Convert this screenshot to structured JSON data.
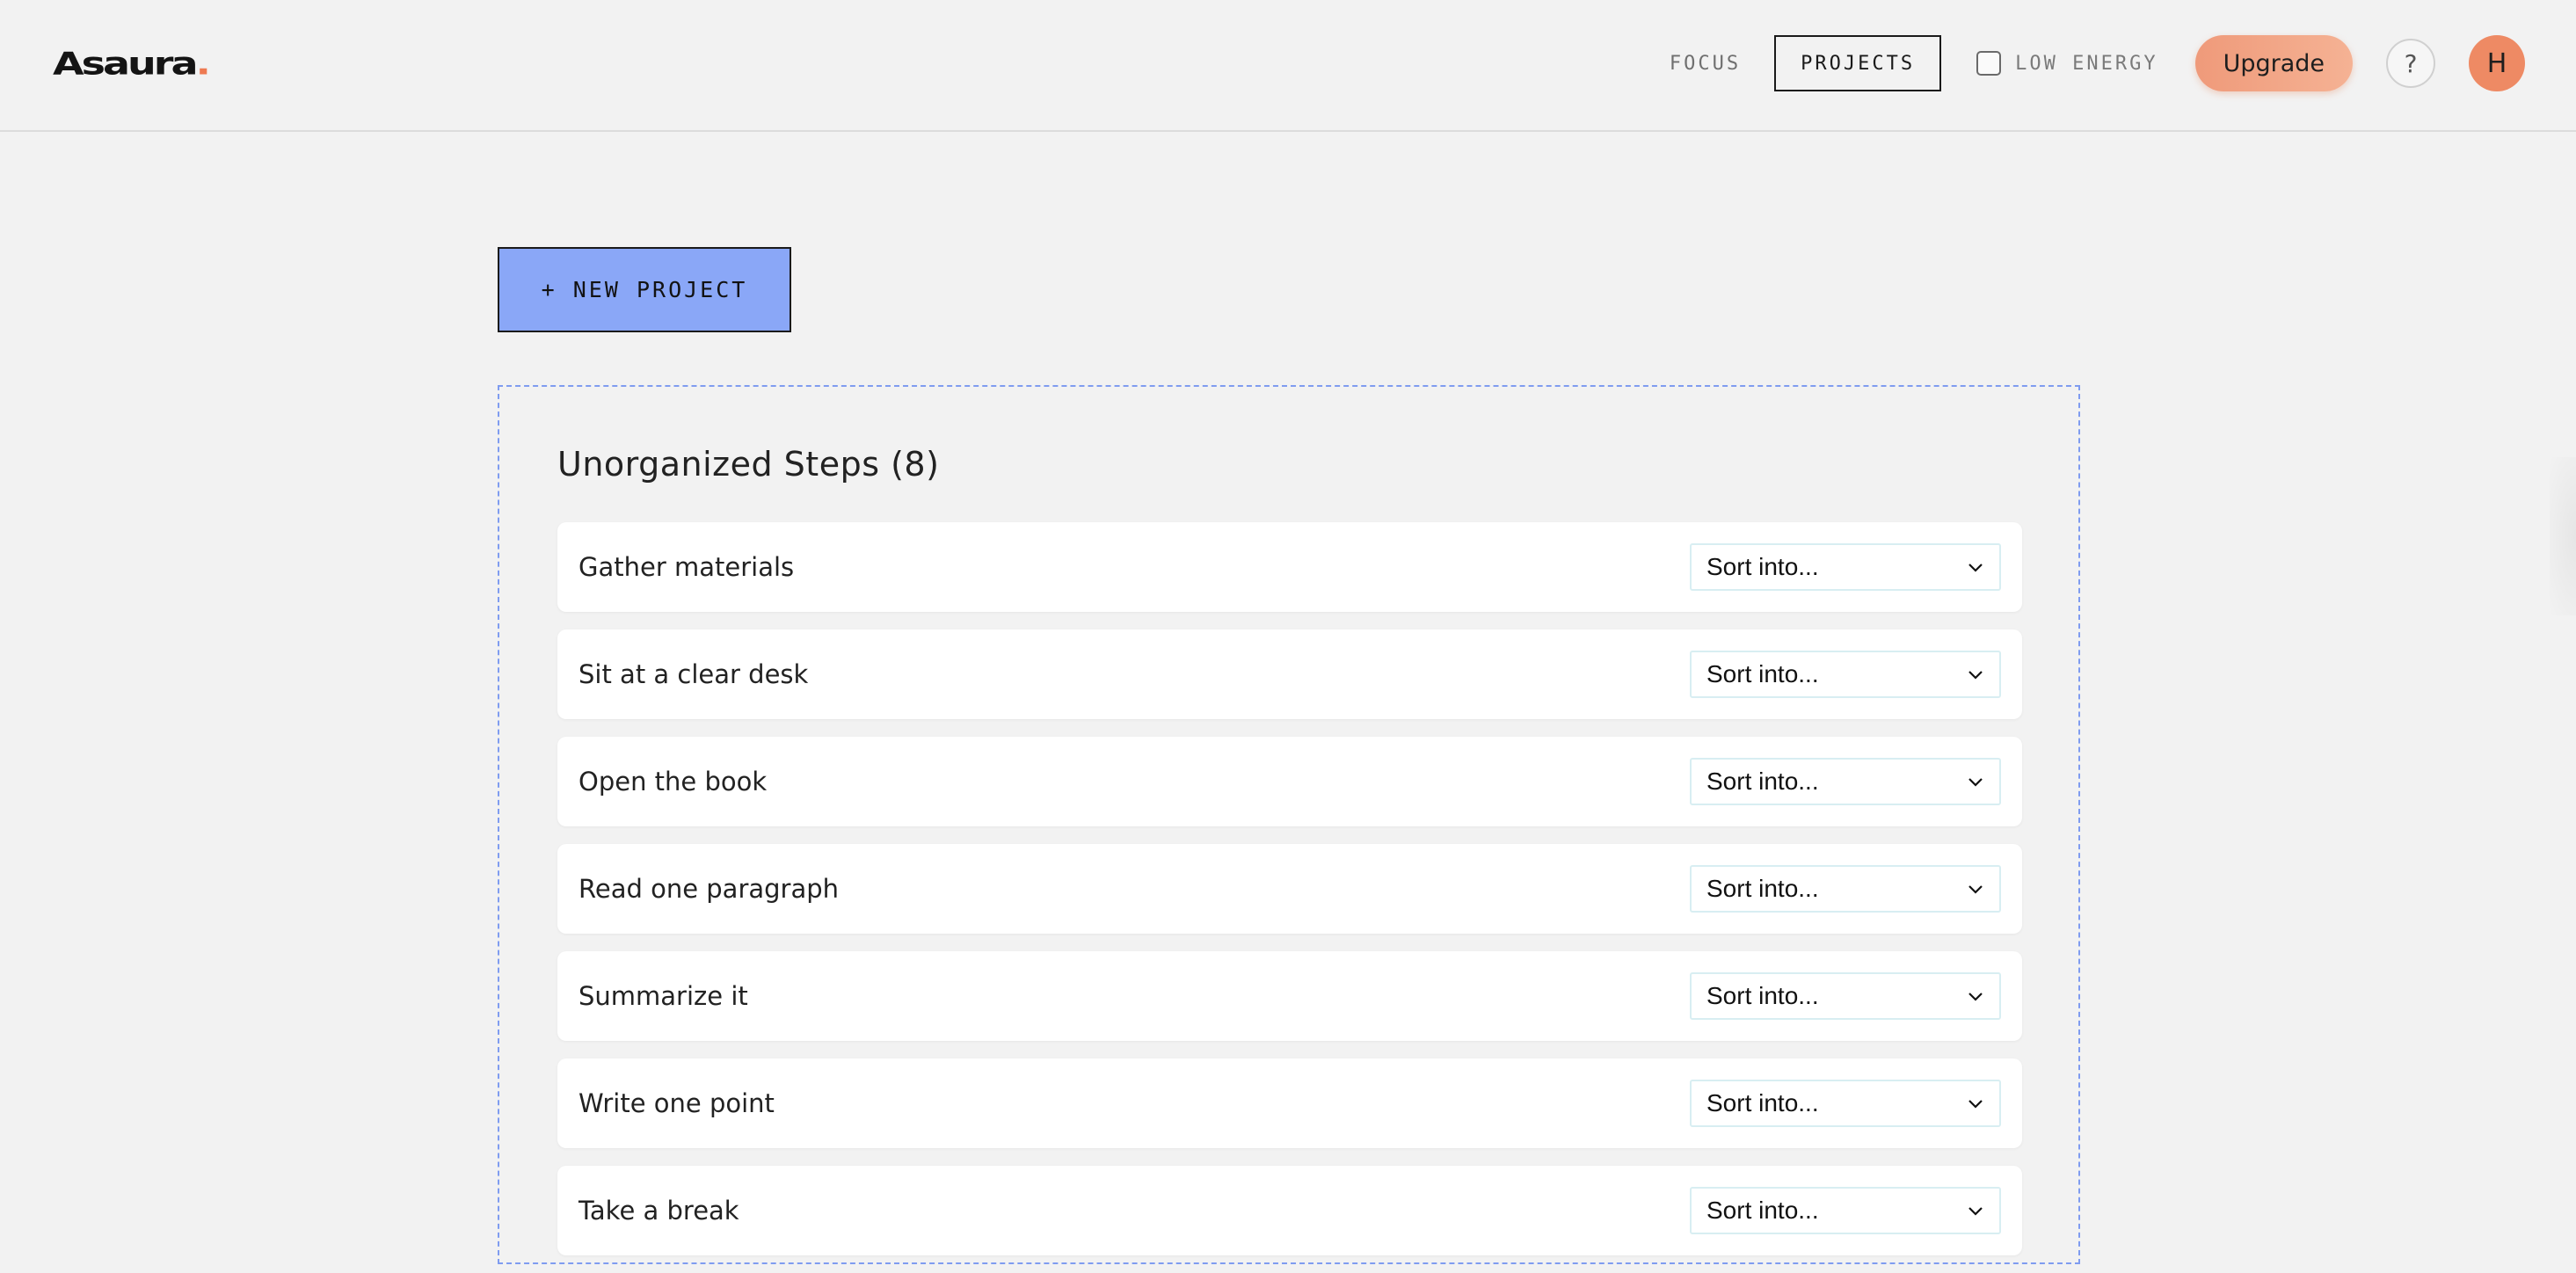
{
  "app": {
    "logo_text": "Asaura",
    "logo_dot": "."
  },
  "nav": {
    "focus_label": "FOCUS",
    "projects_label": "PROJECTS",
    "low_energy_label": "LOW ENERGY",
    "low_energy_checked": false,
    "upgrade_label": "Upgrade",
    "help_label": "?",
    "avatar_initial": "H"
  },
  "main": {
    "new_project_label": "+ NEW PROJECT",
    "section_title": "Unorganized Steps (8)",
    "steps": [
      {
        "label": "Gather materials",
        "select": "Sort into..."
      },
      {
        "label": "Sit at a clear desk",
        "select": "Sort into..."
      },
      {
        "label": "Open the book",
        "select": "Sort into..."
      },
      {
        "label": "Read one paragraph",
        "select": "Sort into..."
      },
      {
        "label": "Summarize it",
        "select": "Sort into..."
      },
      {
        "label": "Write one point",
        "select": "Sort into..."
      },
      {
        "label": "Take a break",
        "select": "Sort into..."
      }
    ]
  },
  "colors": {
    "background": "#f2f2f2",
    "accent_blue": "#8aa7f7",
    "upgrade_orange": "#ef9a7a",
    "avatar_orange": "#ee8a64",
    "dashed_border": "#7f9cf0"
  },
  "icons": [
    "chevron-down-icon",
    "checkbox-icon",
    "help-icon"
  ]
}
